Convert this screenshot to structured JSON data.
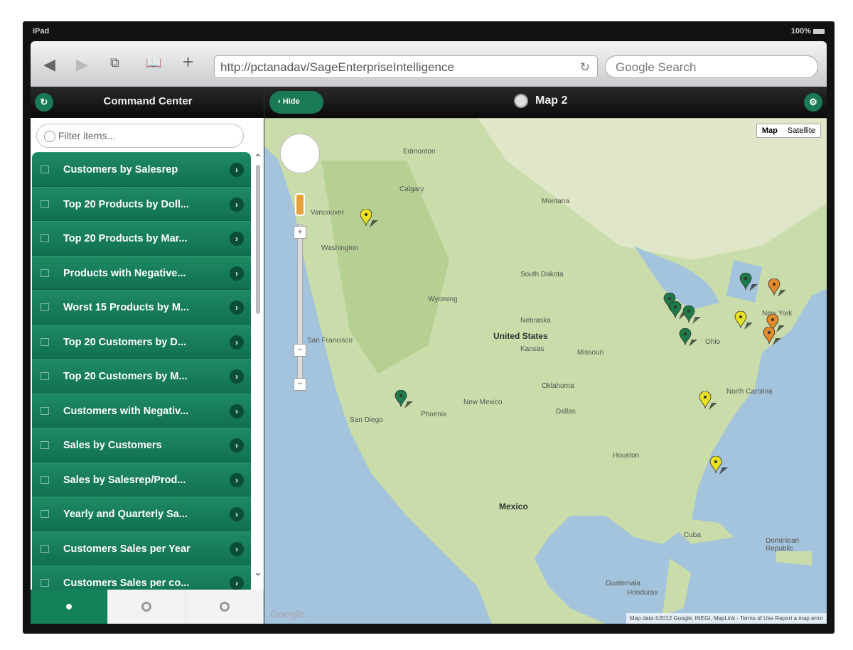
{
  "status": {
    "device": "iPad",
    "battery": "100%"
  },
  "browser": {
    "url": "http://pctanadav/SageEnterpriseIntelligence",
    "search_placeholder": "Google Search"
  },
  "header": {
    "left_title": "Command Center",
    "hide_label": "Hide",
    "map_title": "Map 2"
  },
  "sidebar": {
    "filter_placeholder": "Filter items...",
    "items": [
      {
        "label": "Customers by Salesrep",
        "icon": "table-icon"
      },
      {
        "label": "Top 20 Products by Doll...",
        "icon": "table-icon"
      },
      {
        "label": "Top 20 Products by Mar...",
        "icon": "table-icon"
      },
      {
        "label": "Products with Negative...",
        "icon": "table-icon"
      },
      {
        "label": "Worst 15 Products by M...",
        "icon": "table-icon"
      },
      {
        "label": "Top 20 Customers by D...",
        "icon": "table-icon"
      },
      {
        "label": "Top 20 Customers by M...",
        "icon": "table-icon"
      },
      {
        "label": "Customers with Negativ...",
        "icon": "table-icon"
      },
      {
        "label": "Sales by Customers",
        "icon": "bar-chart-icon"
      },
      {
        "label": "Sales by Salesrep/Prod...",
        "icon": "table-icon"
      },
      {
        "label": "Yearly and Quarterly Sa...",
        "icon": "table-icon"
      },
      {
        "label": "Customers Sales per Year",
        "icon": "table-icon"
      },
      {
        "label": "Customers Sales per co...",
        "icon": "table-icon"
      }
    ]
  },
  "map": {
    "type_map": "Map",
    "type_satellite": "Satellite",
    "logo": "Google",
    "attribution": "Map data ©2012 Google, INEGI, MapLink - Terms of Use  Report a map error",
    "labels": [
      {
        "t": "Edmonton",
        "bold": false
      },
      {
        "t": "Calgary",
        "bold": false
      },
      {
        "t": "Vancouver",
        "bold": false
      },
      {
        "t": "Washington",
        "bold": false
      },
      {
        "t": "Montana",
        "bold": false
      },
      {
        "t": "Wyoming",
        "bold": false
      },
      {
        "t": "South Dakota",
        "bold": false
      },
      {
        "t": "Nebraska",
        "bold": false
      },
      {
        "t": "United States",
        "bold": true
      },
      {
        "t": "Kansas",
        "bold": false
      },
      {
        "t": "Missouri",
        "bold": false
      },
      {
        "t": "Oklahoma",
        "bold": false
      },
      {
        "t": "Dallas",
        "bold": false
      },
      {
        "t": "San Francisco",
        "bold": false
      },
      {
        "t": "San Diego",
        "bold": false
      },
      {
        "t": "Phoenix",
        "bold": false
      },
      {
        "t": "New Mexico",
        "bold": false
      },
      {
        "t": "Mexico",
        "bold": true
      },
      {
        "t": "Cuba",
        "bold": false
      },
      {
        "t": "Dominican Republic",
        "bold": false
      },
      {
        "t": "Guatemala",
        "bold": false
      },
      {
        "t": "Honduras",
        "bold": false
      },
      {
        "t": "New York",
        "bold": false
      },
      {
        "t": "Ohio",
        "bold": false
      },
      {
        "t": "North Carolina",
        "bold": false
      },
      {
        "t": "Houston",
        "bold": false
      }
    ],
    "marker_colors": {
      "yellow": "#e8e020",
      "green": "#1e7a48",
      "orange": "#e08a2a"
    }
  }
}
